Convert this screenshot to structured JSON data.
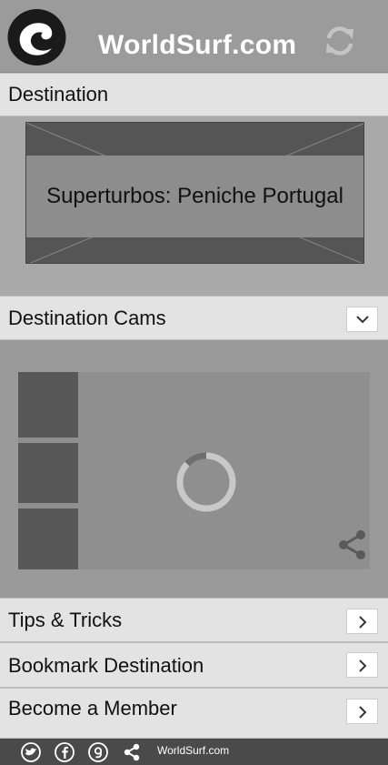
{
  "header": {
    "brand": "WorldSurf.com",
    "logo_icon": "wave-logo-icon",
    "refresh_icon": "refresh-icon"
  },
  "destination": {
    "section_label": "Destination",
    "title": "Superturbos: Peniche Portugal"
  },
  "cams": {
    "section_label": "Destination Cams",
    "toggle_icon": "chevron-down-icon",
    "loading_icon": "loading-spinner-icon",
    "share_icon": "share-icon"
  },
  "menu": [
    {
      "label": "Tips & Tricks",
      "icon": "chevron-right-icon"
    },
    {
      "label": "Bookmark Destination",
      "icon": "chevron-right-icon"
    },
    {
      "label": "Become a Member",
      "icon": "chevron-right-icon"
    }
  ],
  "footer": {
    "icons": [
      "twitter-icon",
      "facebook-icon",
      "google-plus-icon",
      "share-icon"
    ],
    "site_label": "WorldSurf.com"
  },
  "colors": {
    "header_bg": "#9b9b9b",
    "section_bar_bg": "#e3e3e3",
    "footer_bg": "#4a4a4a",
    "brand_text": "#ffffff"
  }
}
